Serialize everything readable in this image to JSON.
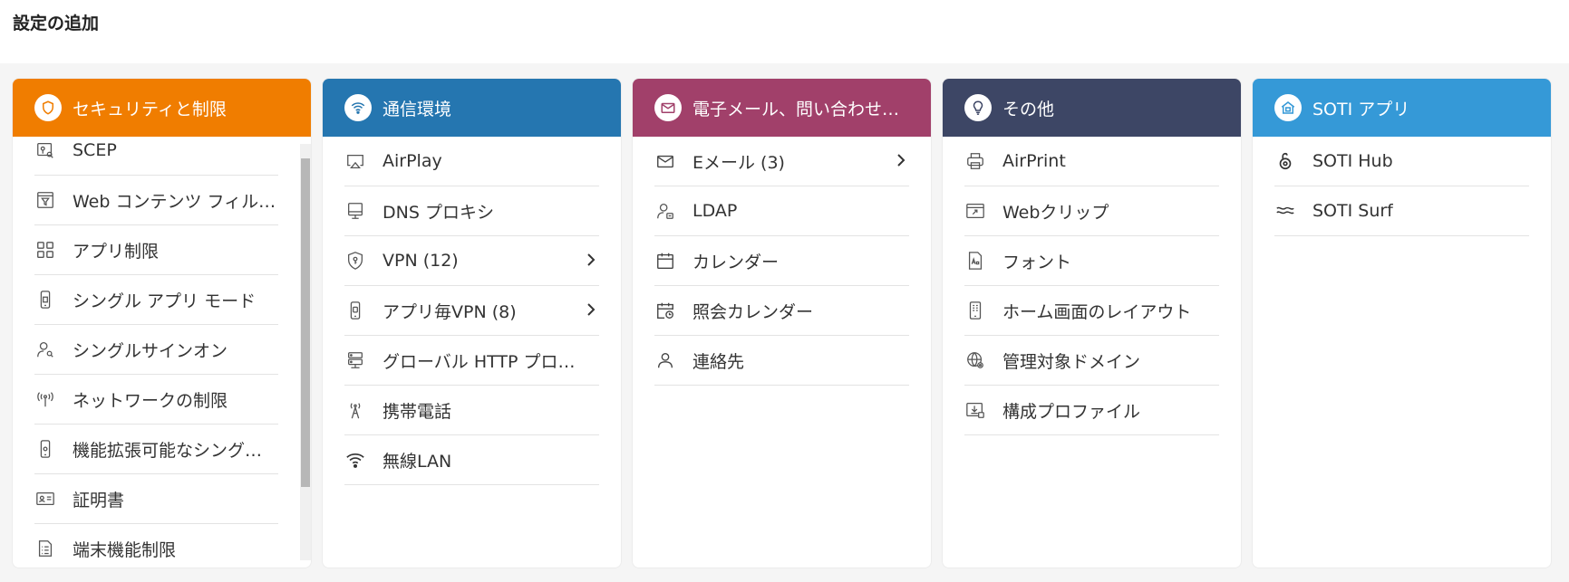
{
  "page": {
    "title": "設定の追加"
  },
  "colors": {
    "security": "#f07d00",
    "network": "#2576b0",
    "email": "#a1406a",
    "other": "#3d4665",
    "soti": "#3599d7"
  },
  "cards": {
    "security": {
      "title": "セキュリティと制限",
      "icon": "shield-icon",
      "items": [
        {
          "label": "SCEP",
          "icon": "certificate-key-icon"
        },
        {
          "label": "Web コンテンツ フィルター",
          "icon": "web-filter-icon"
        },
        {
          "label": "アプリ制限",
          "icon": "app-grid-icon"
        },
        {
          "label": "シングル アプリ モード",
          "icon": "phone-icon"
        },
        {
          "label": "シングルサインオン",
          "icon": "user-key-icon"
        },
        {
          "label": "ネットワークの制限",
          "icon": "antenna-icon"
        },
        {
          "label": "機能拡張可能なシングルサインオン",
          "icon": "phone-icon"
        },
        {
          "label": "証明書",
          "icon": "id-card-icon"
        },
        {
          "label": "端末機能制限",
          "icon": "checklist-icon"
        }
      ]
    },
    "network": {
      "title": "通信環境",
      "icon": "wifi-icon",
      "items": [
        {
          "label": "AirPlay",
          "icon": "airplay-icon"
        },
        {
          "label": "DNS プロキシ",
          "icon": "monitor-icon"
        },
        {
          "label": "VPN (12)",
          "icon": "shield-key-icon"
        },
        {
          "label": "アプリ毎VPN (8)",
          "icon": "phone-icon"
        },
        {
          "label": "グローバル HTTP プロキシ",
          "icon": "server-icon"
        },
        {
          "label": "携帯電話",
          "icon": "cell-tower-icon"
        },
        {
          "label": "無線LAN",
          "icon": "wifi-icon"
        }
      ]
    },
    "email": {
      "title": "電子メール、問い合わせ先、カレンダー",
      "icon": "mail-icon",
      "items": [
        {
          "label": "Eメール (3)",
          "icon": "mail-icon"
        },
        {
          "label": "LDAP",
          "icon": "ldap-user-icon"
        },
        {
          "label": "カレンダー",
          "icon": "calendar-icon"
        },
        {
          "label": "照会カレンダー",
          "icon": "calendar-clock-icon"
        },
        {
          "label": "連絡先",
          "icon": "user-icon"
        }
      ]
    },
    "other": {
      "title": "その他",
      "icon": "lightbulb-icon",
      "items": [
        {
          "label": "AirPrint",
          "icon": "printer-icon"
        },
        {
          "label": "Webクリップ",
          "icon": "web-clip-icon"
        },
        {
          "label": "フォント",
          "icon": "font-file-icon"
        },
        {
          "label": "ホーム画面のレイアウト",
          "icon": "phone-layout-icon"
        },
        {
          "label": "管理対象ドメイン",
          "icon": "globe-gear-icon"
        },
        {
          "label": "構成プロファイル",
          "icon": "profile-download-icon"
        }
      ]
    },
    "soti": {
      "title": "SOTI アプリ",
      "icon": "home-app-icon",
      "items": [
        {
          "label": "SOTI Hub",
          "icon": "lock-hub-icon"
        },
        {
          "label": "SOTI Surf",
          "icon": "waves-icon"
        }
      ]
    }
  }
}
